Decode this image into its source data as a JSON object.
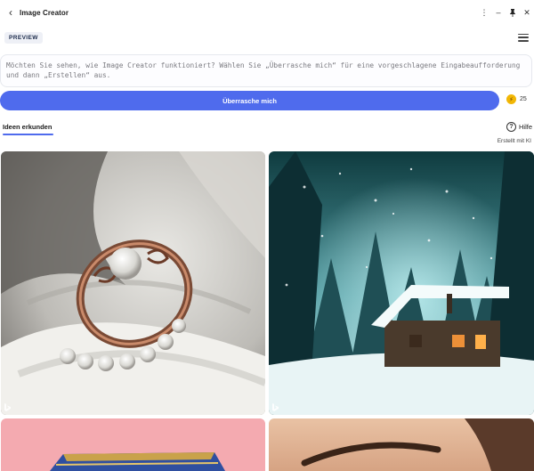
{
  "window": {
    "title": "Image Creator",
    "controls": {
      "more": "⋮",
      "minimize": "–",
      "pin": "📌",
      "close": "✕"
    }
  },
  "header": {
    "preview_badge": "PREVIEW"
  },
  "prompt": {
    "placeholder": "Möchten Sie sehen, wie Image Creator funktioniert? Wählen Sie „Überrasche mich“ für eine vorgeschlagene Eingabeaufforderung und dann „Erstellen“ aus.",
    "value": ""
  },
  "actions": {
    "surprise_label": "Überrasche mich",
    "boost_count": "25"
  },
  "tabs": {
    "explore_label": "Ideen erkunden"
  },
  "help": {
    "label": "Hilfe"
  },
  "created_with_ai": "Erstellt mit KI",
  "gallery": [
    {
      "subject": "pearl-ring",
      "icon": "bing-logo-icon"
    },
    {
      "subject": "snowy-cabin",
      "icon": "bing-logo-icon"
    },
    {
      "subject": "book",
      "icon": "bing-logo-icon"
    },
    {
      "subject": "portrait-eyebrow",
      "icon": "bing-logo-icon"
    }
  ],
  "colors": {
    "accent": "#4f6bed",
    "boost": "#f2b705"
  }
}
